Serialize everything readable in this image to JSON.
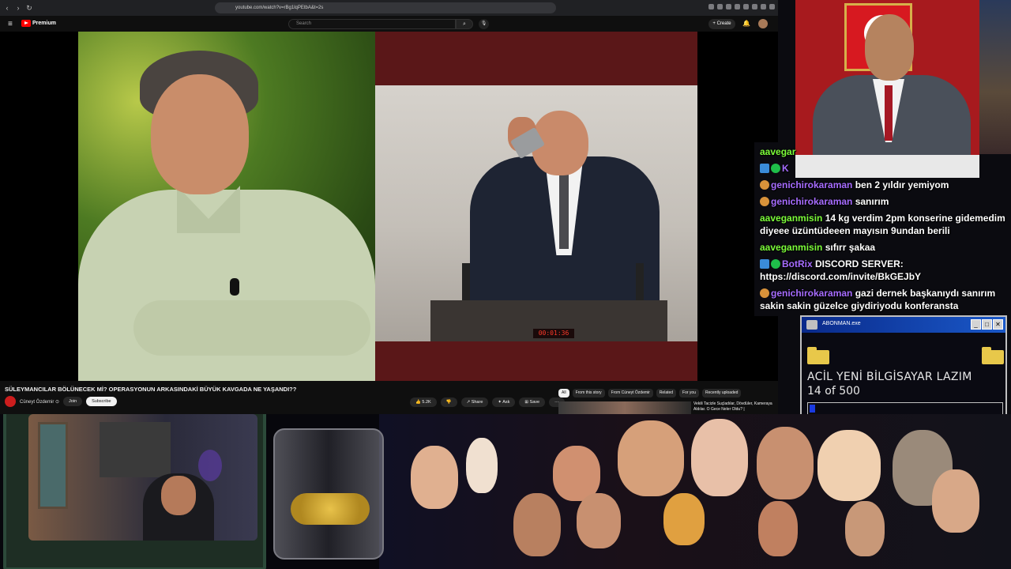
{
  "browser": {
    "url": "youtube.com/watch?v=rBg1lqPEtbA&t=2s"
  },
  "youtube": {
    "brand": "Premium",
    "search_placeholder": "Search",
    "search_glyph": "⌕",
    "mic_glyph": "🎙",
    "create_label": "+ Create",
    "bell_glyph": "🔔",
    "menu_glyph": "≡",
    "podium_timer": "00:01:36",
    "video_title": "SÜLEYMANCILAR BÖLÜNECEK Mİ? OPERASYONUN ARKASINDAKİ BÜYÜK KAVGADA NE YAŞANDI??",
    "channel_name": "Cüneyt Özdemir ⊙",
    "join_label": "Join",
    "subscribe_label": "Subscribe",
    "actions": {
      "likes": "👍 5.2K",
      "dislike": "👎",
      "share": "↗ Share",
      "ask": "✦ Ask",
      "save": "⊞ Save",
      "more": "···"
    },
    "chips": [
      "All",
      "From this story",
      "From Cüneyt Özdemir",
      "Related",
      "For you",
      "Recently uploaded"
    ],
    "recommended_title": "Vekili Tacizle Suçladılar, Dövdüler, Kameraya Aldılar. O Gece Neler Oldu? |"
  },
  "chat": [
    {
      "user": "aavegar",
      "text": "",
      "color": "#7cfc3a",
      "badges": []
    },
    {
      "user": "K",
      "text": "",
      "color": "#a66cff",
      "badges": [
        "b-blue",
        "b-verify"
      ]
    },
    {
      "user": "genichirokaraman",
      "text": "ben 2 yıldır yemiyom",
      "color": "#a66cff",
      "badges": [
        "b-face"
      ]
    },
    {
      "user": "genichirokaraman",
      "text": "sanırım",
      "color": "#a66cff",
      "badges": [
        "b-face"
      ]
    },
    {
      "user": "aaveganmisin",
      "text": "14 kg verdim 2pm konserine gidemedim diyeee üzüntüdeeen mayısın 9undan berili",
      "color": "#7cfc3a",
      "badges": []
    },
    {
      "user": "aaveganmisin",
      "text": "sıfırr şakaa",
      "color": "#7cfc3a",
      "badges": []
    },
    {
      "user": "BotRix",
      "text": "DISCORD SERVER: https://discord.com/invite/BkGEJbY",
      "color": "#a66cff",
      "badges": [
        "b-blue",
        "b-verify"
      ]
    },
    {
      "user": "genichirokaraman",
      "text": "gazi dernek başkanıydı sanırım sakin sakin güzelce giydiriyodu konferansta",
      "color": "#a66cff",
      "badges": [
        "b-face"
      ]
    }
  ],
  "donation": {
    "window_title": "ABONMAN.exe",
    "message": "ACİL YENİ BİLGİSAYAR LAZIM",
    "count_label": "14 of 500",
    "progress": 0.028,
    "min_glyph": "_",
    "max_glyph": "□",
    "close_glyph": "✕"
  },
  "colors": {
    "chat_green": "#7cfc3a",
    "chat_purple": "#a66cff",
    "progress_blue": "#1a3ae0",
    "yt_red": "#ff0000"
  }
}
